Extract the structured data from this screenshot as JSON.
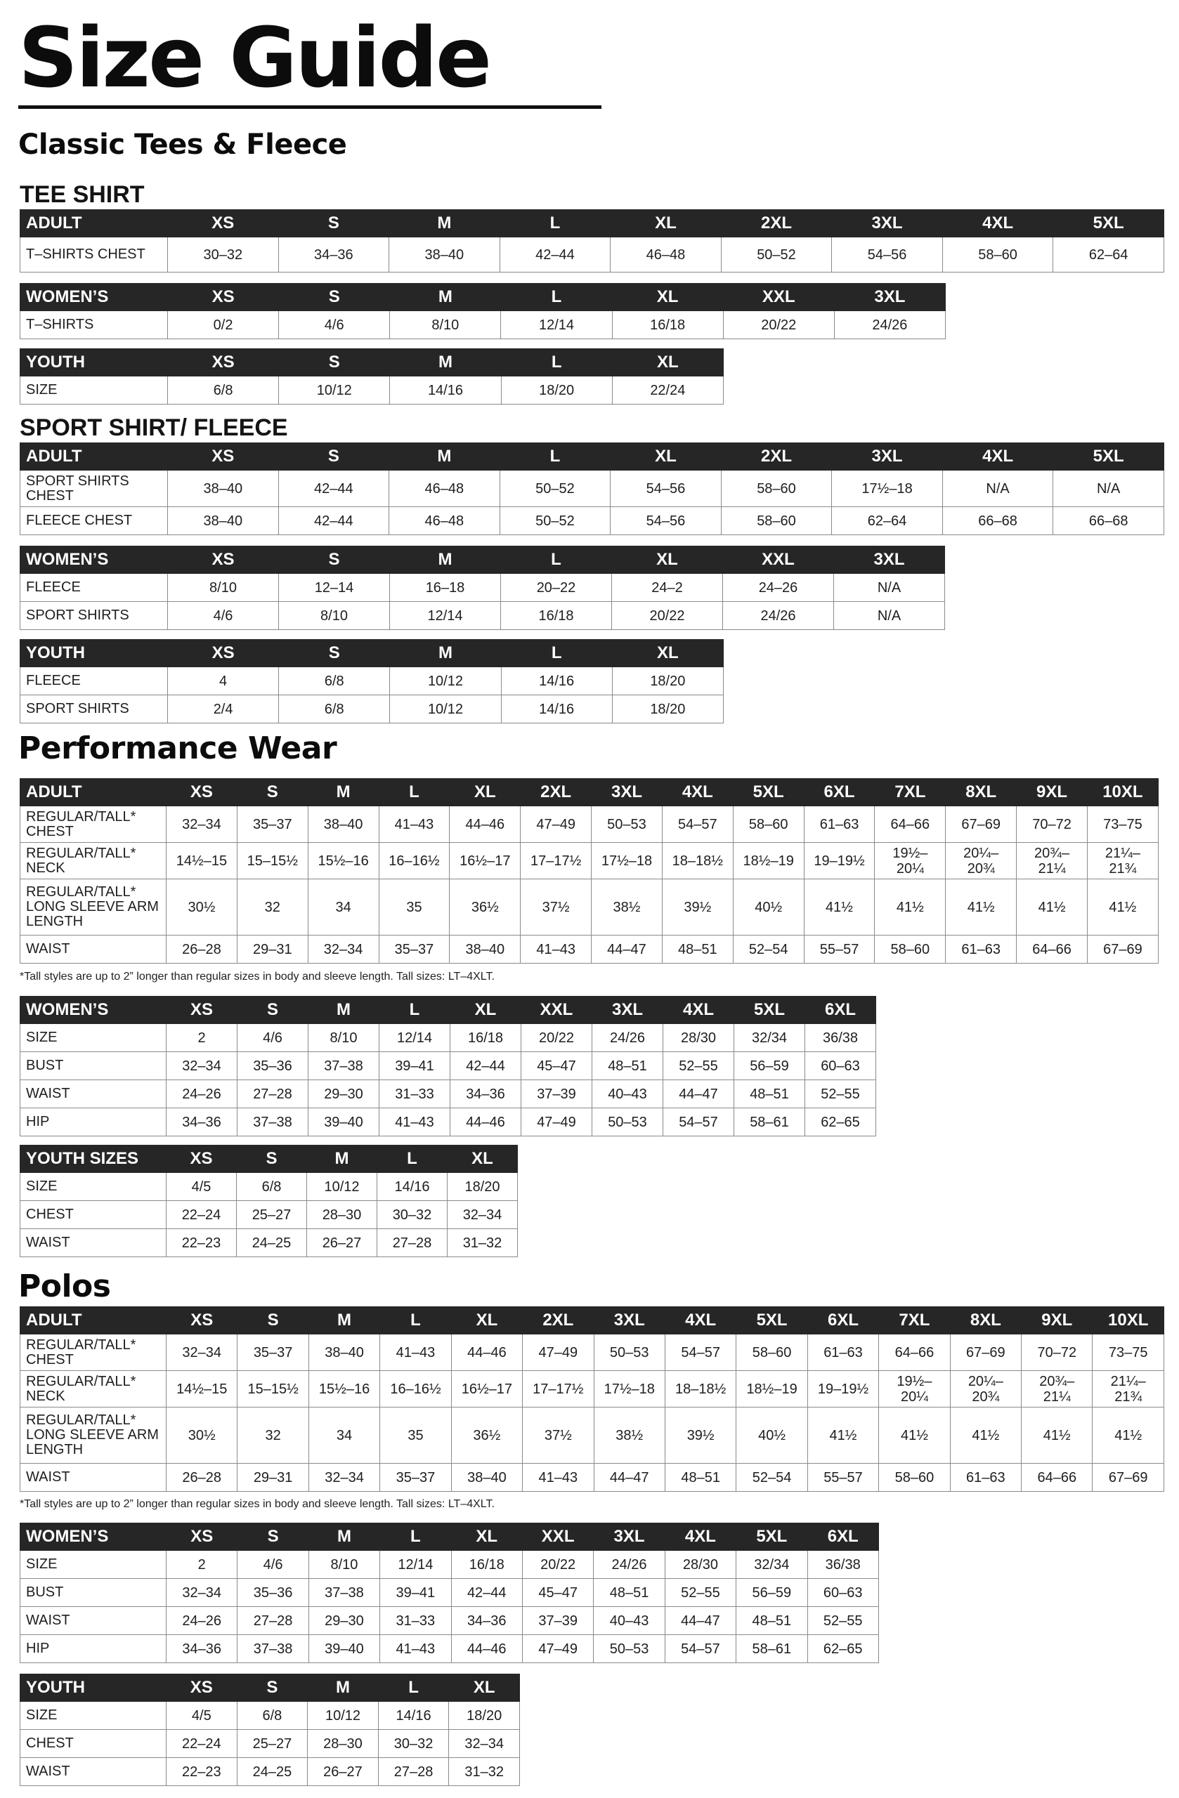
{
  "title": "Size Guide",
  "classic_heading": "Classic Tees & Fleece",
  "tee_heading": "TEE SHIRT",
  "sport_heading": "SPORT SHIRT/ FLEECE",
  "performance_heading": "Performance Wear",
  "polos_heading": "Polos",
  "tall_note": "*Tall styles are up to 2” longer than regular sizes in body and sleeve length. Tall sizes: LT–4XLT.",
  "tables": {
    "tee_adult": {
      "header": [
        "ADULT",
        "XS",
        "S",
        "M",
        "L",
        "XL",
        "2XL",
        "3XL",
        "4XL",
        "5XL"
      ],
      "rows": [
        [
          "T–SHIRTS CHEST",
          "30–32",
          "34–36",
          "38–40",
          "42–44",
          "46–48",
          "50–52",
          "54–56",
          "58–60",
          "62–64"
        ]
      ]
    },
    "tee_women": {
      "header": [
        "WOMEN’S",
        "XS",
        "S",
        "M",
        "L",
        "XL",
        "XXL",
        "3XL"
      ],
      "rows": [
        [
          "T–SHIRTS",
          "0/2",
          "4/6",
          "8/10",
          "12/14",
          "16/18",
          "20/22",
          "24/26"
        ]
      ]
    },
    "tee_youth": {
      "header": [
        "YOUTH",
        "XS",
        "S",
        "M",
        "L",
        "XL"
      ],
      "rows": [
        [
          "SIZE",
          "6/8",
          "10/12",
          "14/16",
          "18/20",
          "22/24"
        ]
      ]
    },
    "sport_adult": {
      "header": [
        "ADULT",
        "XS",
        "S",
        "M",
        "L",
        "XL",
        "2XL",
        "3XL",
        "4XL",
        "5XL"
      ],
      "rows": [
        [
          "SPORT SHIRTS CHEST",
          "38–40",
          "42–44",
          "46–48",
          "50–52",
          "54–56",
          "58–60",
          "17½–18",
          "N/A",
          "N/A"
        ],
        [
          "FLEECE CHEST",
          "38–40",
          "42–44",
          "46–48",
          "50–52",
          "54–56",
          "58–60",
          "62–64",
          "66–68",
          "66–68"
        ]
      ]
    },
    "sport_women": {
      "header": [
        "WOMEN’S",
        "XS",
        "S",
        "M",
        "L",
        "XL",
        "XXL",
        "3XL"
      ],
      "rows": [
        [
          "FLEECE",
          "8/10",
          "12–14",
          "16–18",
          "20–22",
          "24–2",
          "24–26",
          "N/A"
        ],
        [
          "SPORT SHIRTS",
          "4/6",
          "8/10",
          "12/14",
          "16/18",
          "20/22",
          "24/26",
          "N/A"
        ]
      ]
    },
    "sport_youth": {
      "header": [
        "YOUTH",
        "XS",
        "S",
        "M",
        "L",
        "XL"
      ],
      "rows": [
        [
          "FLEECE",
          "4",
          "6/8",
          "10/12",
          "14/16",
          "18/20"
        ],
        [
          "SPORT SHIRTS",
          "2/4",
          "6/8",
          "10/12",
          "14/16",
          "18/20"
        ]
      ]
    },
    "perf_adult": {
      "header": [
        "ADULT",
        "XS",
        "S",
        "M",
        "L",
        "XL",
        "2XL",
        "3XL",
        "4XL",
        "5XL",
        "6XL",
        "7XL",
        "8XL",
        "9XL",
        "10XL"
      ],
      "rows": [
        [
          "REGULAR/TALL* CHEST",
          "32–34",
          "35–37",
          "38–40",
          "41–43",
          "44–46",
          "47–49",
          "50–53",
          "54–57",
          "58–60",
          "61–63",
          "64–66",
          "67–69",
          "70–72",
          "73–75"
        ],
        [
          "REGULAR/TALL* NECK",
          "14½–15",
          "15–15½",
          "15½–16",
          "16–16½",
          "16½–17",
          "17–17½",
          "17½–18",
          "18–18½",
          "18½–19",
          "19–19½",
          "19½– 20¼",
          "20¼– 20¾",
          "20¾– 21¼",
          "21¼– 21¾"
        ],
        [
          "REGULAR/TALL* LONG SLEEVE ARM LENGTH",
          "30½",
          "32",
          "34",
          "35",
          "36½",
          "37½",
          "38½",
          "39½",
          "40½",
          "41½",
          "41½",
          "41½",
          "41½",
          "41½"
        ],
        [
          "WAIST",
          "26–28",
          "29–31",
          "32–34",
          "35–37",
          "38–40",
          "41–43",
          "44–47",
          "48–51",
          "52–54",
          "55–57",
          "58–60",
          "61–63",
          "64–66",
          "67–69"
        ]
      ]
    },
    "perf_women": {
      "header": [
        "WOMEN’S",
        "XS",
        "S",
        "M",
        "L",
        "XL",
        "XXL",
        "3XL",
        "4XL",
        "5XL",
        "6XL"
      ],
      "rows": [
        [
          "SIZE",
          "2",
          "4/6",
          "8/10",
          "12/14",
          "16/18",
          "20/22",
          "24/26",
          "28/30",
          "32/34",
          "36/38"
        ],
        [
          "BUST",
          "32–34",
          "35–36",
          "37–38",
          "39–41",
          "42–44",
          "45–47",
          "48–51",
          "52–55",
          "56–59",
          "60–63"
        ],
        [
          "WAIST",
          "24–26",
          "27–28",
          "29–30",
          "31–33",
          "34–36",
          "37–39",
          "40–43",
          "44–47",
          "48–51",
          "52–55"
        ],
        [
          "HIP",
          "34–36",
          "37–38",
          "39–40",
          "41–43",
          "44–46",
          "47–49",
          "50–53",
          "54–57",
          "58–61",
          "62–65"
        ]
      ]
    },
    "perf_youth": {
      "header": [
        "YOUTH SIZES",
        "XS",
        "S",
        "M",
        "L",
        "XL"
      ],
      "rows": [
        [
          "SIZE",
          "4/5",
          "6/8",
          "10/12",
          "14/16",
          "18/20"
        ],
        [
          "CHEST",
          "22–24",
          "25–27",
          "28–30",
          "30–32",
          "32–34"
        ],
        [
          "WAIST",
          "22–23",
          "24–25",
          "26–27",
          "27–28",
          "31–32"
        ]
      ]
    },
    "polo_adult": {
      "header": [
        "ADULT",
        "XS",
        "S",
        "M",
        "L",
        "XL",
        "2XL",
        "3XL",
        "4XL",
        "5XL",
        "6XL",
        "7XL",
        "8XL",
        "9XL",
        "10XL"
      ],
      "rows": [
        [
          "REGULAR/TALL* CHEST",
          "32–34",
          "35–37",
          "38–40",
          "41–43",
          "44–46",
          "47–49",
          "50–53",
          "54–57",
          "58–60",
          "61–63",
          "64–66",
          "67–69",
          "70–72",
          "73–75"
        ],
        [
          "REGULAR/TALL* NECK",
          "14½–15",
          "15–15½",
          "15½–16",
          "16–16½",
          "16½–17",
          "17–17½",
          "17½–18",
          "18–18½",
          "18½–19",
          "19–19½",
          "19½– 20¼",
          "20¼– 20¾",
          "20¾– 21¼",
          "21¼– 21¾"
        ],
        [
          "REGULAR/TALL* LONG SLEEVE ARM LENGTH",
          "30½",
          "32",
          "34",
          "35",
          "36½",
          "37½",
          "38½",
          "39½",
          "40½",
          "41½",
          "41½",
          "41½",
          "41½",
          "41½"
        ],
        [
          "WAIST",
          "26–28",
          "29–31",
          "32–34",
          "35–37",
          "38–40",
          "41–43",
          "44–47",
          "48–51",
          "52–54",
          "55–57",
          "58–60",
          "61–63",
          "64–66",
          "67–69"
        ]
      ]
    },
    "polo_women": {
      "header": [
        "WOMEN’S",
        "XS",
        "S",
        "M",
        "L",
        "XL",
        "XXL",
        "3XL",
        "4XL",
        "5XL",
        "6XL"
      ],
      "rows": [
        [
          "SIZE",
          "2",
          "4/6",
          "8/10",
          "12/14",
          "16/18",
          "20/22",
          "24/26",
          "28/30",
          "32/34",
          "36/38"
        ],
        [
          "BUST",
          "32–34",
          "35–36",
          "37–38",
          "39–41",
          "42–44",
          "45–47",
          "48–51",
          "52–55",
          "56–59",
          "60–63"
        ],
        [
          "WAIST",
          "24–26",
          "27–28",
          "29–30",
          "31–33",
          "34–36",
          "37–39",
          "40–43",
          "44–47",
          "48–51",
          "52–55"
        ],
        [
          "HIP",
          "34–36",
          "37–38",
          "39–40",
          "41–43",
          "44–46",
          "47–49",
          "50–53",
          "54–57",
          "58–61",
          "62–65"
        ]
      ]
    },
    "polo_youth": {
      "header": [
        "YOUTH",
        "XS",
        "S",
        "M",
        "L",
        "XL"
      ],
      "rows": [
        [
          "SIZE",
          "4/5",
          "6/8",
          "10/12",
          "14/16",
          "18/20"
        ],
        [
          "CHEST",
          "22–24",
          "25–27",
          "28–30",
          "30–32",
          "32–34"
        ],
        [
          "WAIST",
          "22–23",
          "24–25",
          "26–27",
          "27–28",
          "31–32"
        ]
      ]
    }
  }
}
